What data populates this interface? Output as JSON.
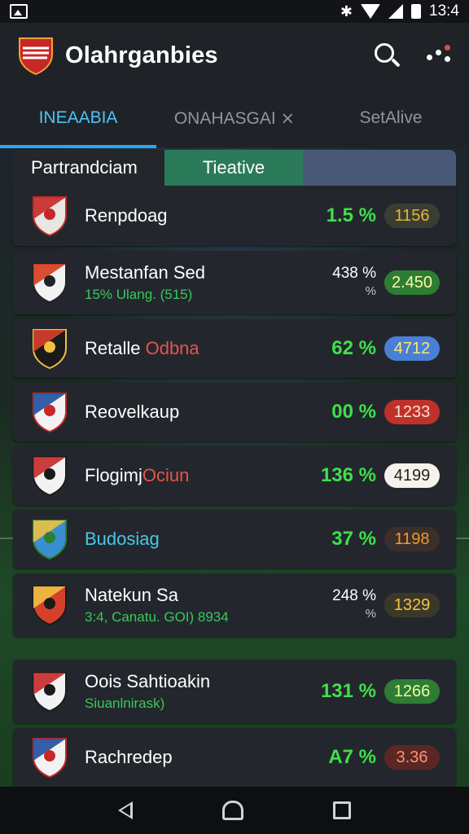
{
  "status_bar": {
    "time": "13:4",
    "icons": [
      "image-icon",
      "bluetooth-icon",
      "wifi-icon",
      "signal-icon",
      "battery-icon"
    ]
  },
  "app": {
    "title": "Olahrganbies",
    "logo": "shield-logo-icon",
    "actions": [
      "search-icon",
      "more-options-icon"
    ]
  },
  "tabs": [
    {
      "label": "INEAABIA",
      "active": true
    },
    {
      "label": "ONAHASGAI ⨯",
      "active": false
    },
    {
      "label": "SetAlive",
      "active": false
    }
  ],
  "segments": {
    "first": "Partrandciam",
    "second": "Tieative"
  },
  "rows": [
    {
      "name": "Renpdoag",
      "name_highlight": "",
      "sub": "",
      "pct": "1.5 %",
      "pct_sub": "",
      "value": "1156",
      "pill_style": "p-dark-yellow",
      "crest": [
        "#e8e6e0",
        "#c62828",
        "#c62828"
      ]
    },
    {
      "name": "Mestanfan Sed",
      "name_highlight": "",
      "sub": "15% Ulang. (515)",
      "pct": "438 %",
      "pct_sub": "%",
      "value": "2.450",
      "pill_style": "p-green",
      "crest": [
        "#f2f2f2",
        "#d63c1e",
        "#222"
      ]
    },
    {
      "name": "Retalle ",
      "name_highlight": "Odbna",
      "sub": "",
      "pct": "62 %",
      "pct_sub": "",
      "value": "4712",
      "pill_style": "p-blue",
      "crest": [
        "#1a1a1a",
        "#d9402a",
        "#f0c040"
      ]
    },
    {
      "name": "Reovelkaup",
      "name_highlight": "",
      "sub": "",
      "pct": "00 %",
      "pct_sub": "",
      "value": "1233",
      "pill_style": "p-red",
      "crest": [
        "#f2f2f2",
        "#1f4fa0",
        "#c62828"
      ]
    },
    {
      "name": "Flogimj",
      "name_highlight": "Ociun",
      "sub": "",
      "pct": "136 %",
      "pct_sub": "",
      "value": "4199",
      "pill_style": "p-white",
      "crest": [
        "#f2f2f2",
        "#c62828",
        "#1a1a1a"
      ]
    },
    {
      "name": "Budosiag",
      "name_highlight": "",
      "sub": "",
      "pct": "37 %",
      "pct_sub": "",
      "value": "1198",
      "pill_style": "p-dark-orange",
      "crest": [
        "#3a8fd0",
        "#f0c040",
        "#2e7d32"
      ],
      "cyan": true
    },
    {
      "name": "Natekun Sa",
      "name_highlight": "",
      "sub": "3:4, Canatu. GOI) 8934",
      "pct": "248 %",
      "pct_sub": "%",
      "value": "1329",
      "pill_style": "p-dark-yellow2",
      "crest": [
        "#d4402a",
        "#f0c040",
        "#1a1a1a"
      ]
    },
    {
      "name": "Oois Sahtioakin",
      "name_highlight": "",
      "sub": "Siuanlnirask)",
      "pct": "131 %",
      "pct_sub": "",
      "value": "1266",
      "pill_style": "p-green2",
      "crest": [
        "#f2f2f2",
        "#c62828",
        "#1a1a1a"
      ]
    },
    {
      "name": "Rachredep",
      "name_highlight": "",
      "sub": "",
      "pct": "A7 %",
      "pct_sub": "",
      "value": "3.36",
      "pill_style": "p-dark-red",
      "crest": [
        "#f2f2f2",
        "#1f4fa0",
        "#c62828"
      ]
    }
  ],
  "nav_bar": [
    "back-icon",
    "home-icon",
    "recent-apps-icon"
  ]
}
